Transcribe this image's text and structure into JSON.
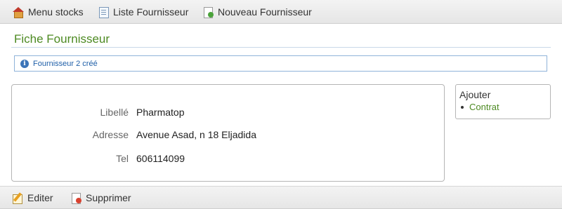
{
  "top_toolbar": {
    "items": [
      {
        "label": "Menu stocks",
        "icon": "home-icon"
      },
      {
        "label": "Liste Fournisseur",
        "icon": "list-icon"
      },
      {
        "label": "Nouveau Fournisseur",
        "icon": "new-document-icon"
      }
    ]
  },
  "page": {
    "title": "Fiche Fournisseur"
  },
  "notice": {
    "icon": "info-icon",
    "text": "Fournisseur 2 créé"
  },
  "details": {
    "fields": [
      {
        "label": "Libellé",
        "value": "Pharmatop"
      },
      {
        "label": "Adresse",
        "value": "Avenue Asad, n 18 Eljadida"
      },
      {
        "label": "Tel",
        "value": "606114099"
      }
    ]
  },
  "side_panel": {
    "heading": "Ajouter",
    "links": [
      {
        "label": "Contrat"
      }
    ]
  },
  "bottom_toolbar": {
    "items": [
      {
        "label": "Editer",
        "icon": "edit-icon"
      },
      {
        "label": "Supprimer",
        "icon": "delete-icon"
      }
    ]
  },
  "colors": {
    "title_green": "#4d8a22",
    "notice_text": "#1f5fa8",
    "notice_border": "#8fb3d9"
  }
}
